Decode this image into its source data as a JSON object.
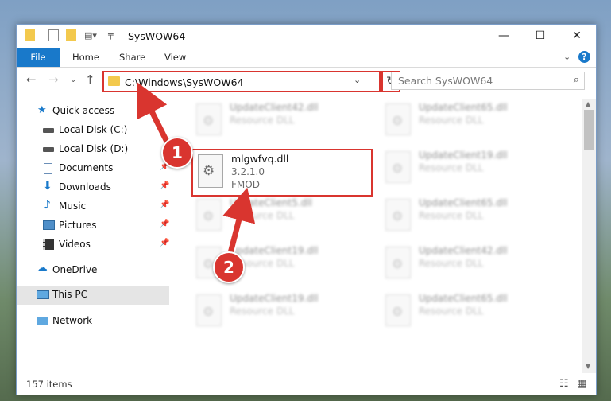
{
  "window": {
    "title": "SysWOW64",
    "controls": {
      "minimize": "—",
      "maximize": "☐",
      "close": "✕"
    }
  },
  "ribbon": {
    "file": "File",
    "home": "Home",
    "share": "Share",
    "view": "View",
    "help": "?"
  },
  "address": {
    "path": "C:\\Windows\\SysWOW64",
    "search_placeholder": "Search SysWOW64"
  },
  "nav": {
    "items": [
      {
        "label": "Quick access",
        "icon": "star-icon",
        "pinned": false
      },
      {
        "label": "Local Disk (C:)",
        "icon": "drive-icon",
        "pinned": false
      },
      {
        "label": "Local Disk (D:)",
        "icon": "drive-icon",
        "pinned": false
      },
      {
        "label": "Documents",
        "icon": "documents-icon",
        "pinned": true
      },
      {
        "label": "Downloads",
        "icon": "download-icon",
        "pinned": true
      },
      {
        "label": "Music",
        "icon": "music-icon",
        "pinned": true
      },
      {
        "label": "Pictures",
        "icon": "pictures-icon",
        "pinned": true
      },
      {
        "label": "Videos",
        "icon": "videos-icon",
        "pinned": true
      },
      {
        "label": "OneDrive",
        "icon": "cloud-icon",
        "pinned": false
      },
      {
        "label": "This PC",
        "icon": "computer-icon",
        "pinned": false
      },
      {
        "label": "Network",
        "icon": "network-icon",
        "pinned": false
      }
    ]
  },
  "files": {
    "left": [
      {
        "name": "UpdateClient42.dll",
        "type": "Resource DLL"
      },
      {
        "name": "UpdateClient5.dll",
        "type": "Resource DLL"
      },
      {
        "name": "UpdateClient19.dll",
        "type": "Resource DLL"
      },
      {
        "name": "UpdateClient19.dll",
        "type": "Resource DLL"
      }
    ],
    "right": [
      {
        "name": "UpdateClient65.dll",
        "type": "Resource DLL"
      },
      {
        "name": "UpdateClient19.dll",
        "type": "Resource DLL"
      },
      {
        "name": "UpdateClient65.dll",
        "type": "Resource DLL"
      },
      {
        "name": "UpdateClient42.dll",
        "type": "Resource DLL"
      },
      {
        "name": "UpdateClient65.dll",
        "type": "Resource DLL"
      }
    ],
    "highlighted": {
      "name": "mlgwfvq.dll",
      "version": "3.2.1.0",
      "company": "FMOD"
    }
  },
  "status": {
    "items": "157 items"
  },
  "callouts": {
    "one": "1",
    "two": "2"
  },
  "colors": {
    "accent": "#1979ca",
    "highlight": "#d9352f",
    "folder": "#f3c94d"
  }
}
